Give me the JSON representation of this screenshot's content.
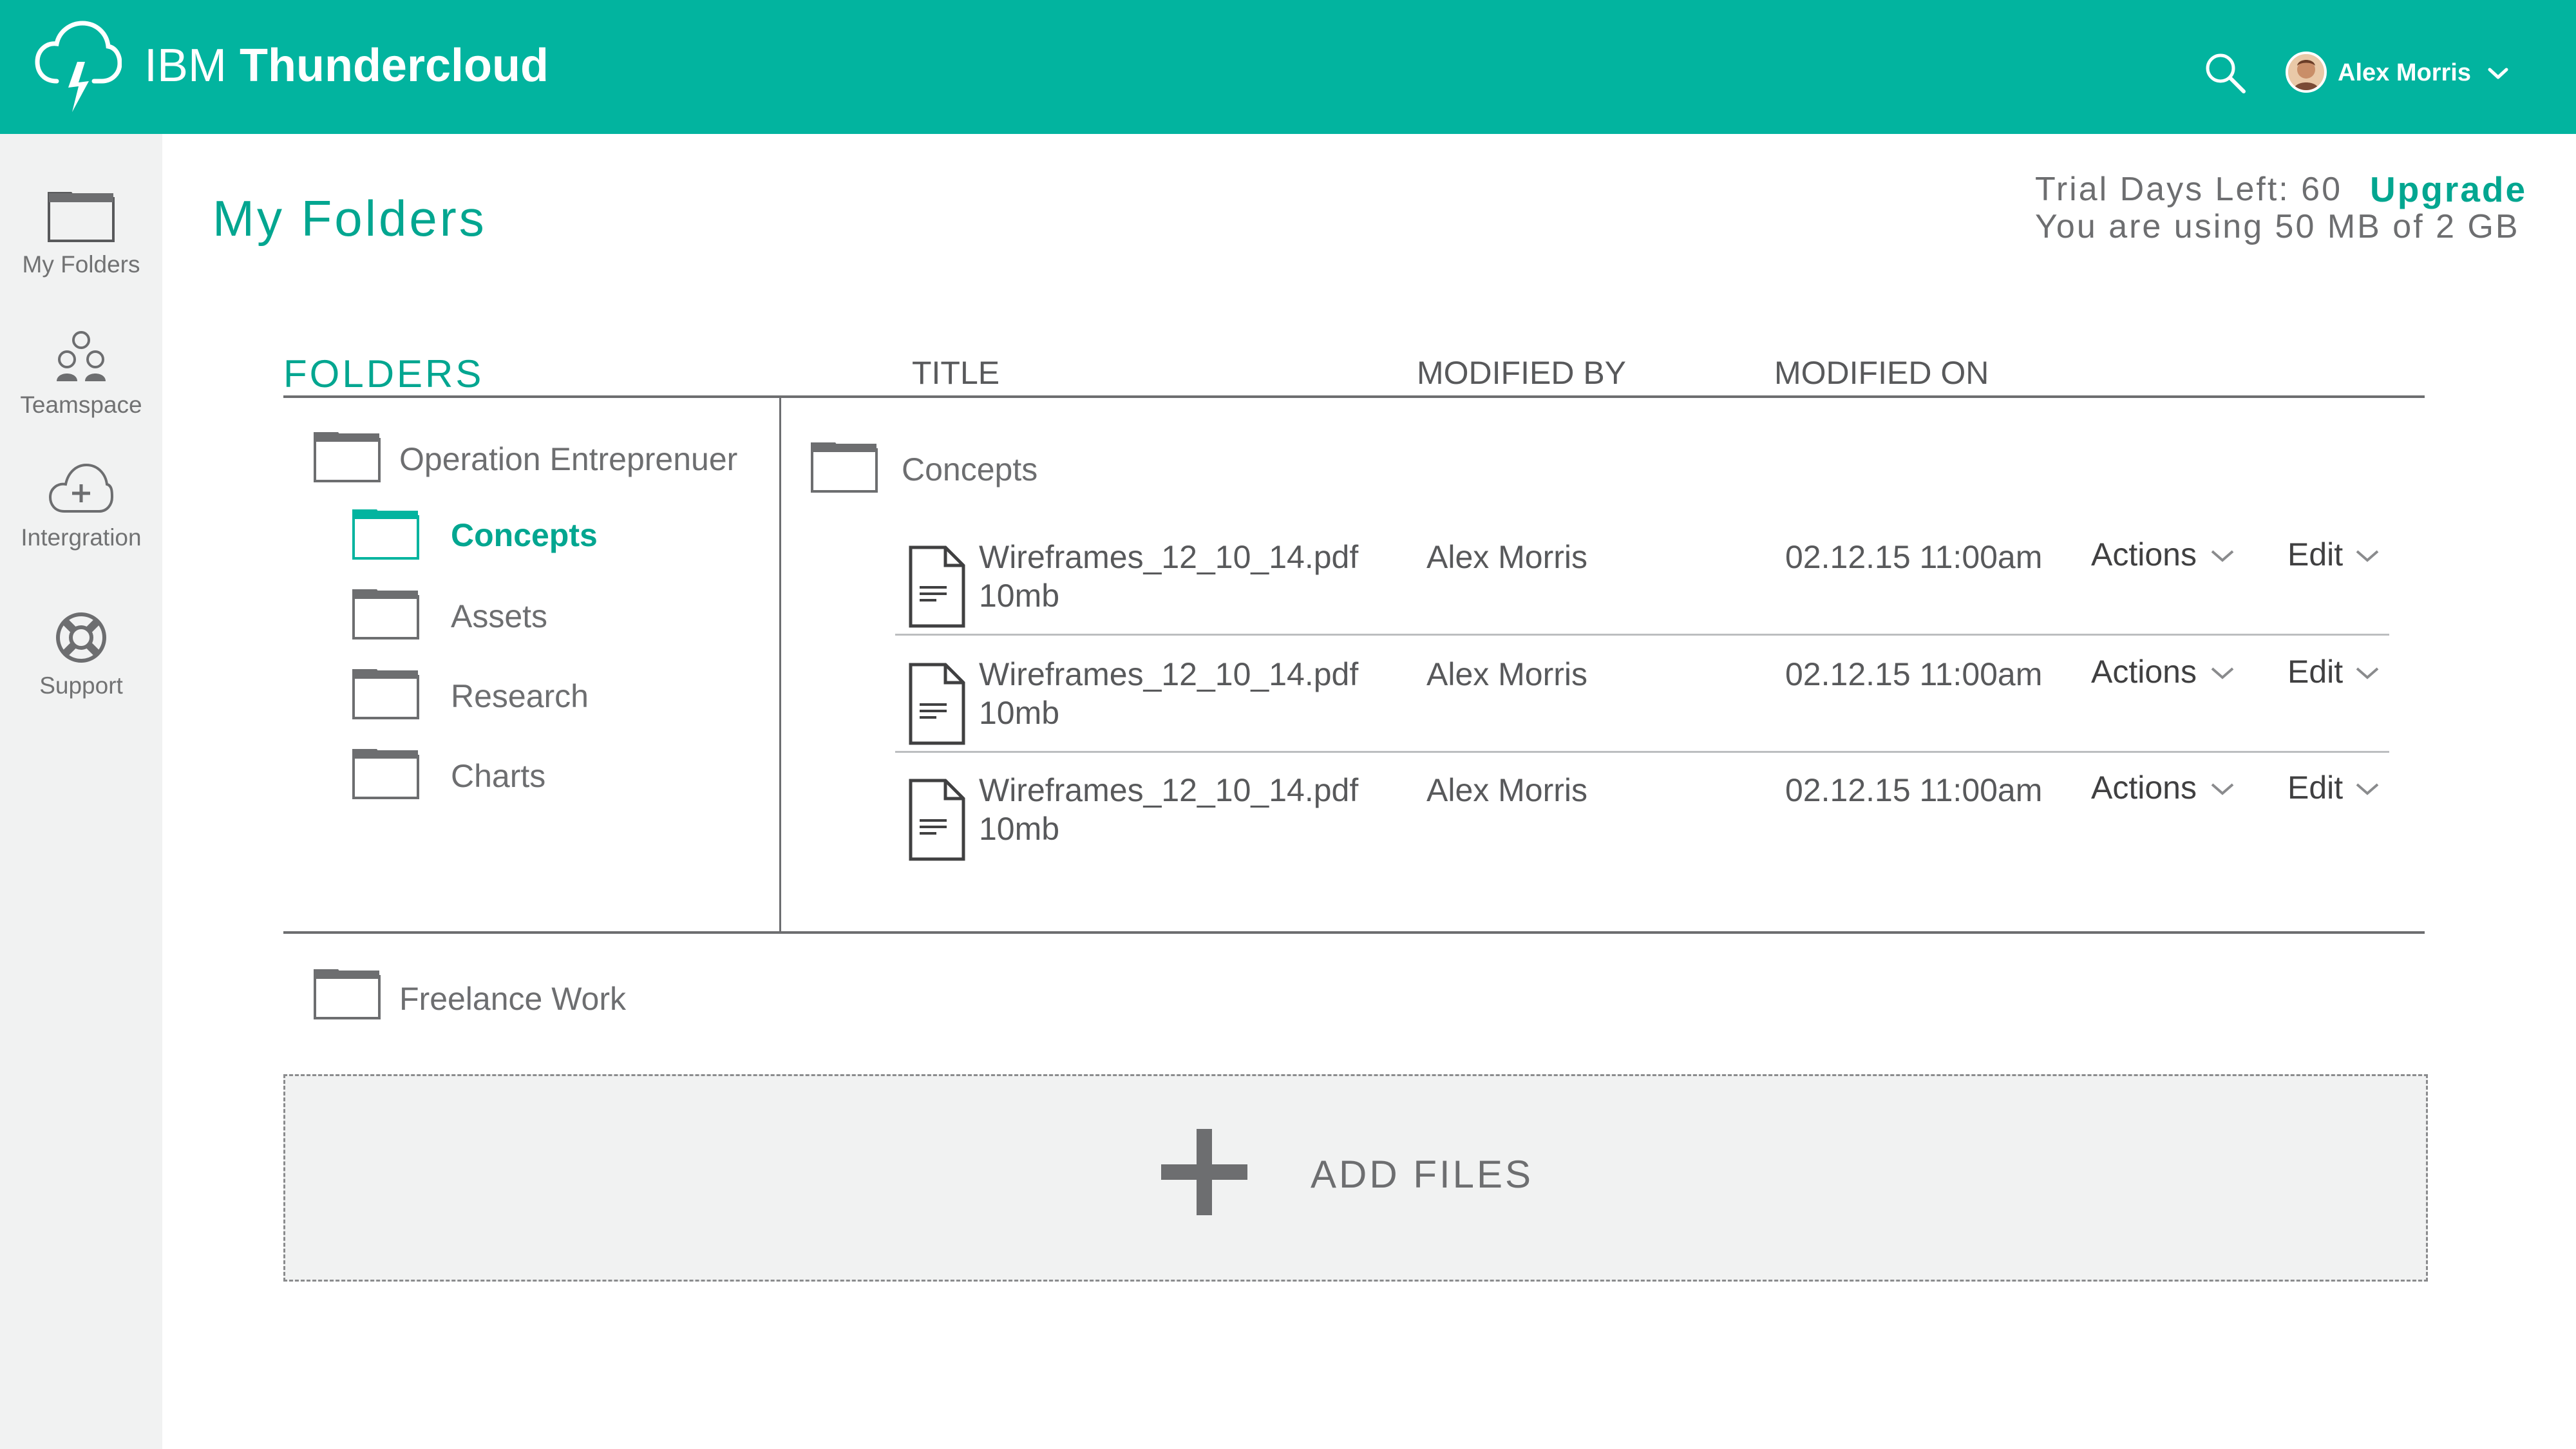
{
  "header": {
    "brand_light": "IBM",
    "brand_bold": "Thundercloud",
    "user_name": "Alex Morris",
    "accent_color": "#02b49f"
  },
  "sidebar": {
    "items": [
      {
        "label": "My Folders",
        "icon": "folder-icon"
      },
      {
        "label": "Teamspace",
        "icon": "people-icon"
      },
      {
        "label": "Intergration",
        "icon": "cloud-plus-icon"
      },
      {
        "label": "Support",
        "icon": "lifebuoy-icon"
      }
    ]
  },
  "main": {
    "title": "My Folders",
    "trial_label": "Trial Days Left: 60",
    "upgrade_label": "Upgrade",
    "usage_text": "You are using 50 MB of 2 GB",
    "columns": {
      "folders": "FOLDERS",
      "title": "TITLE",
      "modified_by": "MODIFIED BY",
      "modified_on": "MODIFIED ON"
    },
    "tree": {
      "root": "Operation Entreprenuer",
      "children": [
        "Concepts",
        "Assets",
        "Research",
        "Charts"
      ],
      "selected": "Concepts",
      "other": "Freelance Work"
    },
    "current_folder": "Concepts",
    "files": [
      {
        "name": "Wireframes_12_10_14.pdf",
        "size": "10mb",
        "modified_by": "Alex Morris",
        "modified_on": "02.12.15 11:00am",
        "actions": "Actions",
        "edit": "Edit"
      },
      {
        "name": "Wireframes_12_10_14.pdf",
        "size": "10mb",
        "modified_by": "Alex Morris",
        "modified_on": "02.12.15 11:00am",
        "actions": "Actions",
        "edit": "Edit"
      },
      {
        "name": "Wireframes_12_10_14.pdf",
        "size": "10mb",
        "modified_by": "Alex Morris",
        "modified_on": "02.12.15 11:00am",
        "actions": "Actions",
        "edit": "Edit"
      }
    ],
    "add_files_label": "ADD FILES"
  }
}
